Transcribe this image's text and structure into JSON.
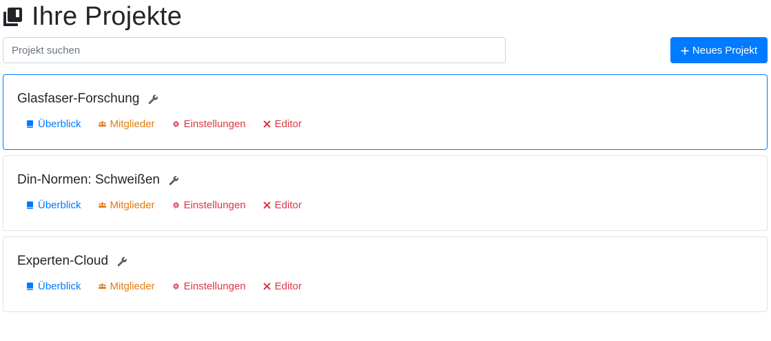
{
  "header": {
    "title": "Ihre Projekte",
    "icon": "books-icon"
  },
  "search": {
    "placeholder": "Projekt suchen",
    "value": ""
  },
  "toolbar": {
    "new_project_label": "Neues Projekt"
  },
  "colors": {
    "primary": "#007bff",
    "overview": "#007bff",
    "members": "#e07b10",
    "settings": "#dc3545",
    "editor": "#dc3545"
  },
  "link_labels": {
    "overview": "Überblick",
    "members": "Mitglieder",
    "settings": "Einstellungen",
    "editor": "Editor"
  },
  "projects": [
    {
      "name": "Glasfaser-Forschung",
      "selected": true
    },
    {
      "name": "Din-Normen: Schweißen",
      "selected": false
    },
    {
      "name": "Experten-Cloud",
      "selected": false
    }
  ]
}
